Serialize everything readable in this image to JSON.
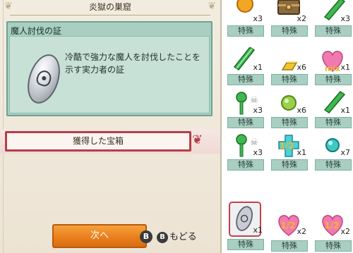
{
  "stage": {
    "title": "炎獄の巣窟"
  },
  "item": {
    "name": "魔人討伐の証",
    "description": "冷酷で強力な魔人を討伐したことを示す実力者の証"
  },
  "section": {
    "title": "獲得した宝箱"
  },
  "buttons": {
    "next_label": "次へ",
    "next_key": "B",
    "back_key": "B",
    "back_label": "もどる"
  },
  "grid": {
    "category_label": "特殊",
    "cells": [
      {
        "icon": "orange-gem-icon",
        "qty": "x3"
      },
      {
        "icon": "treasure-chest-icon",
        "qty": "x2"
      },
      {
        "icon": "green-crystal-icon",
        "qty": "x3"
      },
      {
        "icon": "green-crystal-icon",
        "qty": "x1"
      },
      {
        "icon": "gold-bar-icon",
        "qty": "x6"
      },
      {
        "icon": "mix-heart-icon",
        "qty": "x1",
        "overlay": "mix"
      },
      {
        "icon": "green-key-icon",
        "qty": "x3"
      },
      {
        "icon": "green-orb-icon",
        "qty": "x6"
      },
      {
        "icon": "green-crystal-icon",
        "qty": "x1"
      },
      {
        "icon": "green-key-icon",
        "qty": "x3"
      },
      {
        "icon": "half-cross-icon",
        "qty": "x1",
        "overlay": "1/2"
      },
      {
        "icon": "teal-gem-icon",
        "qty": "x7"
      },
      {
        "icon": "silver-coin-icon",
        "qty": "x1"
      },
      {
        "icon": "half-heart-icon",
        "qty": "x2",
        "overlay": "1/2"
      },
      {
        "icon": "half-heart-icon",
        "qty": "x2",
        "overlay": "1/2"
      }
    ]
  },
  "colors": {
    "accent_red": "#b3404a",
    "label_teal": "#a8cfc2",
    "button_orange": "#e9801d"
  }
}
